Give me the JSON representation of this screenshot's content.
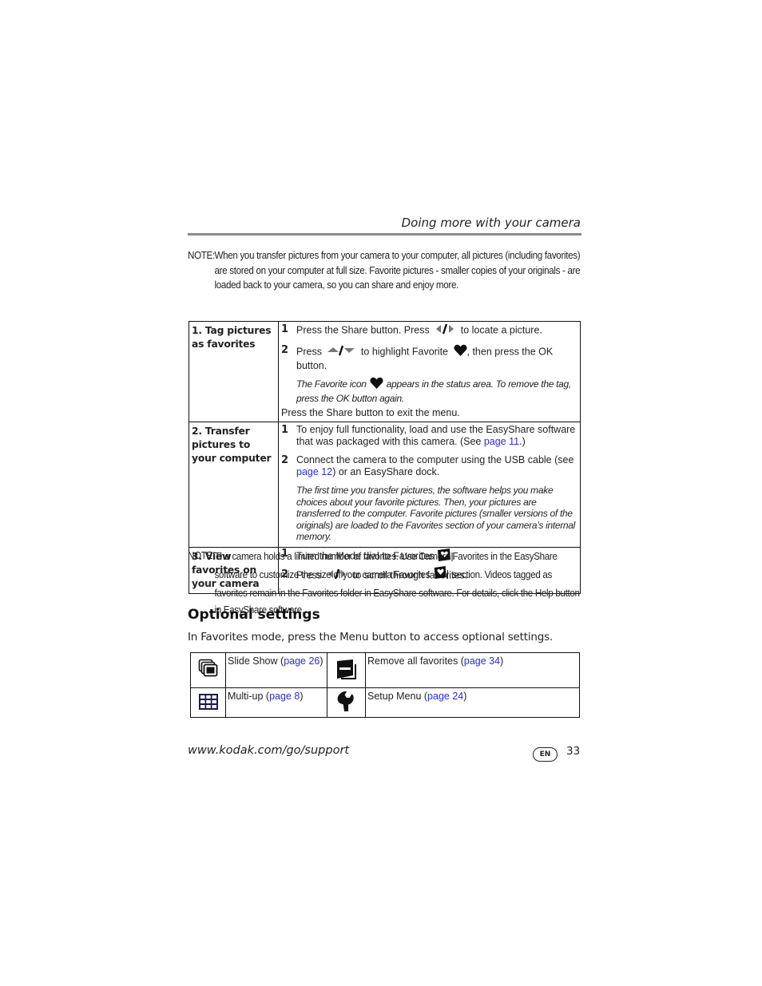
{
  "header": {
    "running_title": "Doing more with your camera"
  },
  "note1": {
    "label": "NOTE:",
    "text": "When you transfer pictures from your camera to your computer, all pictures (including favorites) are stored on your computer at full size. Favorite pictures - smaller copies of your originals - are loaded back to your camera, so you can share and enjoy more."
  },
  "tasks": [
    {
      "title": "1. Tag pictures as favorites",
      "steps": [
        {
          "num": "1",
          "before": "Press the Share button. Press",
          "icon": "left-right-arrows-icon",
          "after": "to locate a picture."
        },
        {
          "num": "2",
          "before": "Press",
          "icon": "up-down-arrows-icon",
          "mid": "to highlight Favorite",
          "icon2": "heart-icon",
          "after": ", then press the OK button."
        }
      ],
      "italic_before": "The Favorite icon",
      "italic_after": "appears in the status area. To remove the tag, press the OK button again.",
      "exit": "Press the Share button to exit the menu."
    },
    {
      "title": "2. Transfer pictures to your computer",
      "steps": [
        {
          "num": "1",
          "before": "To enjoy full functionality, load and use the EasyShare software that was packaged with this camera. (See ",
          "link": "page 11",
          "after": ".)"
        },
        {
          "num": "2",
          "before": "Connect the camera to the computer using the USB cable (see ",
          "link": "page 12",
          "after": ") or an EasyShare dock."
        }
      ],
      "italic": "The first time you transfer pictures, the software helps you make choices about your favorite pictures. Then, your pictures are transferred to the computer. Favorite pictures (smaller versions of the originals) are loaded to the Favorites section of your camera’s internal memory."
    },
    {
      "title": "3. View favorites on your camera",
      "steps": [
        {
          "num": "1",
          "before": "Turn the Mode dial to Favorites",
          "icon": "favorites-mode-icon",
          "after": "."
        },
        {
          "num": "2",
          "before": "Press",
          "icon": "left-right-arrows-icon",
          "after": "to scroll through favorites."
        }
      ]
    }
  ],
  "note2": {
    "label": "NOTE:",
    "before": "The camera holds a limited number of favorites. Use Camera Favorites in the EasyShare software to customize the size of your camera Favorites",
    "after": "section. Videos tagged as favorites remain in the Favorites folder in EasyShare software. For details, click the Help button in EasyShare software."
  },
  "optional_settings": {
    "heading": "Optional settings",
    "intro": "In Favorites mode, press the Menu button to access optional settings.",
    "items": [
      {
        "icon": "slide-show-icon",
        "label": "Slide Show (",
        "link": "page 26",
        "close": ")"
      },
      {
        "icon": "remove-favorites-icon",
        "label": "Remove all favorites (",
        "link": "page 34",
        "close": ")"
      },
      {
        "icon": "multi-up-icon",
        "label": "Multi-up (",
        "link": "page 8",
        "close": ")"
      },
      {
        "icon": "setup-wrench-icon",
        "label": "Setup Menu (",
        "link": "page 24",
        "close": ")"
      }
    ]
  },
  "footer": {
    "url": "www.kodak.com/go/support",
    "language_badge": "EN",
    "page_number": "33"
  },
  "colors": {
    "link": "#2a2ae0",
    "rule": "#8a8a8a",
    "icon_navy": "#1a1a4a"
  }
}
